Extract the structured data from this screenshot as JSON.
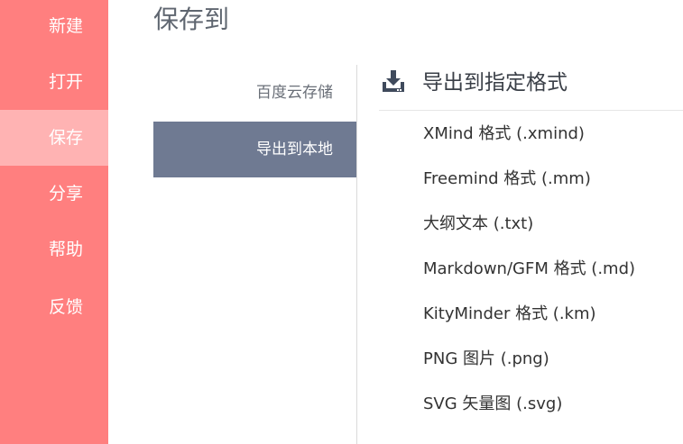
{
  "sidebar": {
    "items": [
      {
        "label": "新建"
      },
      {
        "label": "打开"
      },
      {
        "label": "保存"
      },
      {
        "label": "分享"
      },
      {
        "label": "帮助"
      },
      {
        "label": "反馈"
      }
    ]
  },
  "main": {
    "title": "保存到",
    "tabs": [
      {
        "label": "百度云存储"
      },
      {
        "label": "导出到本地"
      }
    ],
    "panel": {
      "title": "导出到指定格式",
      "icon": "download-icon",
      "formats": [
        {
          "label": "XMind 格式 (.xmind)"
        },
        {
          "label": "Freemind 格式 (.mm)"
        },
        {
          "label": "大纲文本 (.txt)"
        },
        {
          "label": "Markdown/GFM 格式 (.md)"
        },
        {
          "label": "KityMinder 格式 (.km)"
        },
        {
          "label": "PNG 图片 (.png)"
        },
        {
          "label": "SVG 矢量图 (.svg)"
        }
      ]
    }
  },
  "colors": {
    "sidebar_bg": "#ff7f7f",
    "sidebar_active": "#ffb3b3",
    "tab_active": "#6f7a92"
  }
}
